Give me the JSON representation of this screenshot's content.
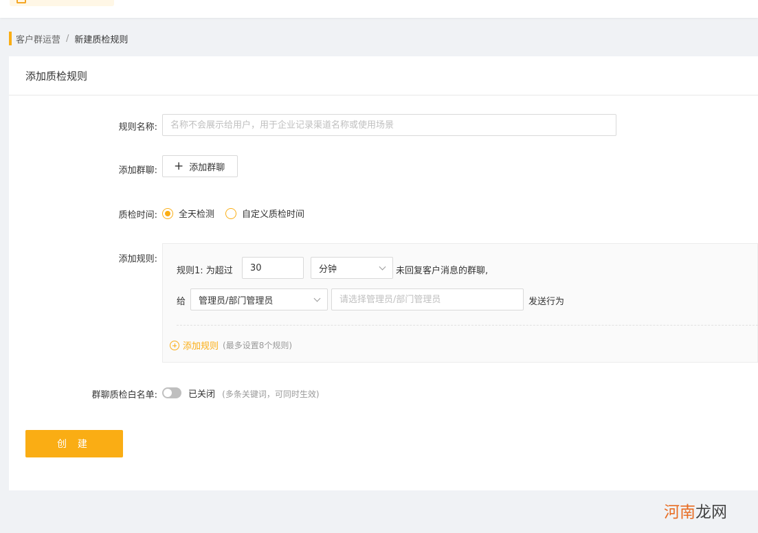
{
  "breadcrumb": {
    "parent": "客户群运营",
    "separator": "/",
    "current": "新建质检规则"
  },
  "card": {
    "title": "添加质检规则"
  },
  "form": {
    "name_label": "规则名称:",
    "name_placeholder": "名称不会展示给用户，用于企业记录渠道名称或使用场景",
    "group_label": "添加群聊:",
    "add_group_button": "添加群聊",
    "time_label": "质检时间:",
    "time_options": [
      {
        "label": "全天检测",
        "checked": true
      },
      {
        "label": "自定义质检时间",
        "checked": false
      }
    ],
    "rules_label": "添加规则:",
    "rule": {
      "prefix": "规则1: 为超过",
      "value": "30",
      "unit": "分钟",
      "suffix": "未回复客户消息的群聊,",
      "give": "给",
      "recipient_type": "管理员/部门管理员",
      "recipient_placeholder": "请选择管理员/部门管理员",
      "action": "发送行为"
    },
    "add_rule": "添加规则",
    "add_rule_hint": "(最多设置8个规则)",
    "whitelist_label": "群聊质检白名单:",
    "whitelist_status": "已关闭",
    "whitelist_hint": "(多条关键词，可同时生效)",
    "whitelist_enabled": false,
    "create_button": "创 建"
  },
  "watermark": {
    "part1": "河南",
    "part2": "龙网"
  },
  "colors": {
    "accent": "#faad14",
    "background": "#f0f2f5"
  }
}
